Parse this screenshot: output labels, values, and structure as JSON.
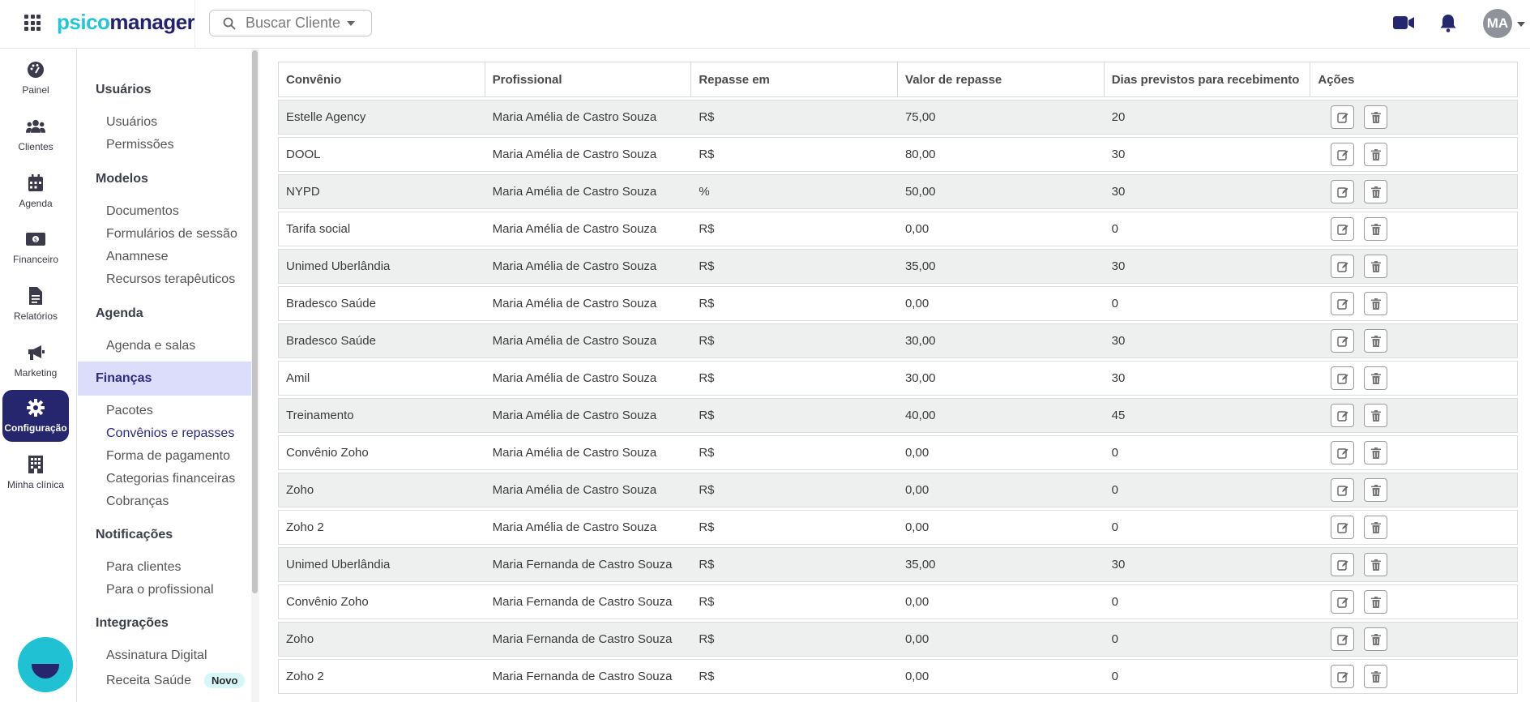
{
  "brand": {
    "part1": "psico",
    "part2": "manager"
  },
  "search": {
    "placeholder": "Buscar Cliente"
  },
  "user": {
    "initials": "MA"
  },
  "rail": [
    {
      "label": "Painel",
      "icon": "dashboard-icon"
    },
    {
      "label": "Clientes",
      "icon": "users-icon"
    },
    {
      "label": "Agenda",
      "icon": "calendar-icon"
    },
    {
      "label": "Financeiro",
      "icon": "money-icon"
    },
    {
      "label": "Relatórios",
      "icon": "report-icon"
    },
    {
      "label": "Marketing",
      "icon": "megaphone-icon"
    },
    {
      "label": "Configuração",
      "icon": "gear-icon",
      "active": true
    },
    {
      "label": "Minha clínica",
      "icon": "building-icon"
    }
  ],
  "settings": {
    "usuarios": "Usuários",
    "usuarios_items": [
      "Usuários",
      "Permissões"
    ],
    "modelos": "Modelos",
    "modelos_items": [
      "Documentos",
      "Formulários de sessão",
      "Anamnese",
      "Recursos terapêuticos"
    ],
    "agenda": "Agenda",
    "agenda_items": [
      "Agenda e salas"
    ],
    "financas": "Finanças",
    "financas_items": [
      "Pacotes",
      "Convênios e repasses",
      "Forma de pagamento",
      "Categorias financeiras",
      "Cobranças"
    ],
    "notificacoes": "Notificações",
    "notificacoes_items": [
      "Para clientes",
      "Para o profissional"
    ],
    "integracoes": "Integrações",
    "integracoes_items": [
      "Assinatura Digital",
      "Receita Saúde"
    ],
    "badge_novo": "Novo"
  },
  "table": {
    "headers": [
      "Convênio",
      "Profissional",
      "Repasse em",
      "Valor de repasse",
      "Dias previstos para recebimento",
      "Ações"
    ],
    "rows": [
      [
        "Estelle Agency",
        "Maria Amélia de Castro Souza",
        "R$",
        "75,00",
        "20"
      ],
      [
        "DOOL",
        "Maria Amélia de Castro Souza",
        "R$",
        "80,00",
        "30"
      ],
      [
        "NYPD",
        "Maria Amélia de Castro Souza",
        "%",
        "50,00",
        "30"
      ],
      [
        "Tarifa social",
        "Maria Amélia de Castro Souza",
        "R$",
        "0,00",
        "0"
      ],
      [
        "Unimed Uberlândia",
        "Maria Amélia de Castro Souza",
        "R$",
        "35,00",
        "30"
      ],
      [
        "Bradesco Saúde",
        "Maria Amélia de Castro Souza",
        "R$",
        "0,00",
        "0"
      ],
      [
        "Bradesco Saúde",
        "Maria Amélia de Castro Souza",
        "R$",
        "30,00",
        "30"
      ],
      [
        "Amil",
        "Maria Amélia de Castro Souza",
        "R$",
        "30,00",
        "30"
      ],
      [
        "Treinamento",
        "Maria Amélia de Castro Souza",
        "R$",
        "40,00",
        "45"
      ],
      [
        "Convênio Zoho",
        "Maria Amélia de Castro Souza",
        "R$",
        "0,00",
        "0"
      ],
      [
        "Zoho",
        "Maria Amélia de Castro Souza",
        "R$",
        "0,00",
        "0"
      ],
      [
        "Zoho 2",
        "Maria Amélia de Castro Souza",
        "R$",
        "0,00",
        "0"
      ],
      [
        "Unimed Uberlândia",
        "Maria Fernanda de Castro Souza",
        "R$",
        "35,00",
        "30"
      ],
      [
        "Convênio Zoho",
        "Maria Fernanda de Castro Souza",
        "R$",
        "0,00",
        "0"
      ],
      [
        "Zoho",
        "Maria Fernanda de Castro Souza",
        "R$",
        "0,00",
        "0"
      ],
      [
        "Zoho 2",
        "Maria Fernanda de Castro Souza",
        "R$",
        "0,00",
        "0"
      ]
    ]
  },
  "colors": {
    "brand_dark": "#26266f",
    "brand_cyan": "#1fc1d3",
    "active_bg": "#dcdcfb"
  }
}
